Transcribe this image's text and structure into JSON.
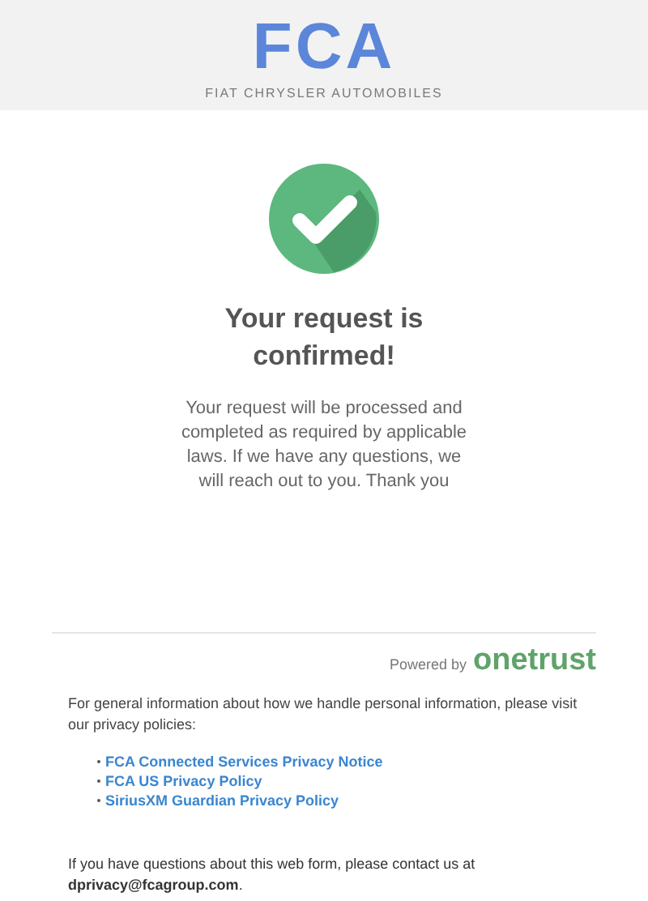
{
  "header": {
    "logo": "FCA",
    "tagline": "FIAT CHRYSLER AUTOMOBILES"
  },
  "confirmation": {
    "title": "Your request is confirmed!",
    "message": "Your request will be processed and completed as required by applicable laws. If we have any questions, we will reach out to you. Thank you"
  },
  "footer": {
    "powered_by": "Powered by",
    "brand": "onetrust",
    "info": "For general information about how we handle personal information, please visit our privacy policies:",
    "links": [
      "FCA Connected Services Privacy Notice",
      "FCA US Privacy Policy",
      "SiriusXM Guardian Privacy Policy"
    ],
    "contact": "If you have questions about this web form, please contact us at **dprivacy@fcagroup.com**."
  }
}
